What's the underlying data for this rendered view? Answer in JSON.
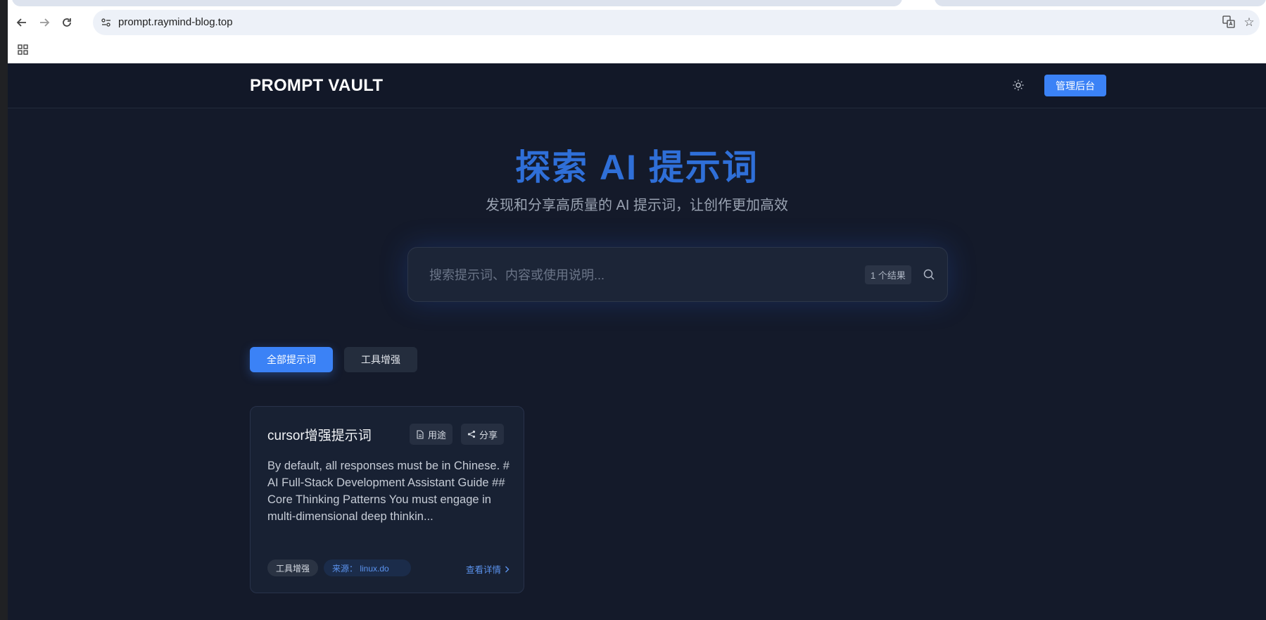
{
  "browser": {
    "url": "prompt.raymind-blog.top"
  },
  "header": {
    "brand": "PROMPT VAULT",
    "admin_label": "管理后台"
  },
  "hero": {
    "title": "探索 AI 提示词",
    "subtitle": "发现和分享高质量的 AI 提示词，让创作更加高效"
  },
  "search": {
    "placeholder": "搜索提示词、内容或使用说明...",
    "value": "",
    "result_count": "1 个结果"
  },
  "categories": [
    {
      "label": "全部提示词",
      "active": true
    },
    {
      "label": "工具增强",
      "active": false
    }
  ],
  "cards": [
    {
      "title": "cursor增强提示词",
      "usage_label": "用途",
      "share_label": "分享",
      "excerpt": "By default, all responses must be in Chinese. # AI Full-Stack Development Assistant Guide ## Core Thinking Patterns You must engage in multi-dimensional deep thinkin...",
      "category_tag": "工具增强",
      "source_tag": "来源： linux.do",
      "detail_label": "查看详情"
    }
  ],
  "colors": {
    "accent": "#3b82f6",
    "hero_title": "#2f6fd8",
    "page_bg": "#141a2a"
  }
}
